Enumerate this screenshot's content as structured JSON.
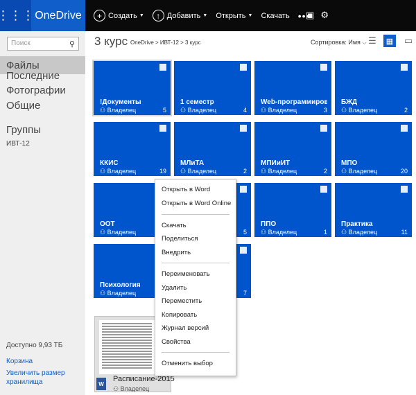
{
  "topbar": {
    "brand": "OneDrive",
    "commands": [
      {
        "label": "Создать",
        "icon": "plus-icon",
        "glyph": "+",
        "caret": true
      },
      {
        "label": "Добавить",
        "icon": "upload-icon",
        "glyph": "↑",
        "caret": true
      },
      {
        "label": "Открыть",
        "caret": true
      },
      {
        "label": "Скачать"
      },
      {
        "label": "•••"
      }
    ]
  },
  "nav": {
    "search_placeholder": "Поиск",
    "items": [
      "Файлы",
      "Последние",
      "Фотографии",
      "Общие"
    ],
    "groups_title": "Группы",
    "group": "ИВТ-12",
    "storage": "Доступно 9,93 ТБ",
    "recycle": "Корзина",
    "upgrade": "Увеличить размер хранилища"
  },
  "header": {
    "title": "3 курс",
    "breadcrumb": "OneDrive > ИВТ-12 > 3 курс",
    "sort": "Сортировка: Имя"
  },
  "tiles": [
    {
      "name": "!Документы",
      "owner": "Владелец",
      "count": "5"
    },
    {
      "name": "1 семестр",
      "owner": "Владелец",
      "count": "4"
    },
    {
      "name": "Web-программиров...",
      "owner": "Владелец",
      "count": "3"
    },
    {
      "name": "БЖД",
      "owner": "Владелец",
      "count": "2"
    },
    {
      "name": "ККИС",
      "owner": "Владелец",
      "count": "19"
    },
    {
      "name": "МЛиТА",
      "owner": "Владелец",
      "count": "2"
    },
    {
      "name": "МПИиИТ",
      "owner": "Владелец",
      "count": "2"
    },
    {
      "name": "МПО",
      "owner": "Владелец",
      "count": "20"
    },
    {
      "name": "ООТ",
      "owner": "Владелец",
      "count": ""
    },
    {
      "name": "",
      "owner": "",
      "count": "5"
    },
    {
      "name": "ППО",
      "owner": "Владелец",
      "count": "1"
    },
    {
      "name": "Практика",
      "owner": "Владелец",
      "count": "11"
    },
    {
      "name": "Психология",
      "owner": "Владелец",
      "count": ""
    },
    {
      "name": "",
      "owner": "",
      "count": "7"
    }
  ],
  "document": {
    "name": "Расписание-2015",
    "owner": "Владелец",
    "app": "W"
  },
  "context_menu": {
    "open_word": "Открыть в Word",
    "open_word_online": "Открыть в Word Online",
    "download": "Скачать",
    "share": "Поделиться",
    "embed": "Внедрить",
    "rename": "Переименовать",
    "delete": "Удалить",
    "move": "Переместить",
    "copy": "Копировать",
    "history": "Журнал версий",
    "properties": "Свойства",
    "deselect": "Отменить выбор"
  },
  "colors": {
    "tile": "#0055cc",
    "accent": "#0f5ec9",
    "topbar": "#0a0a0a"
  }
}
